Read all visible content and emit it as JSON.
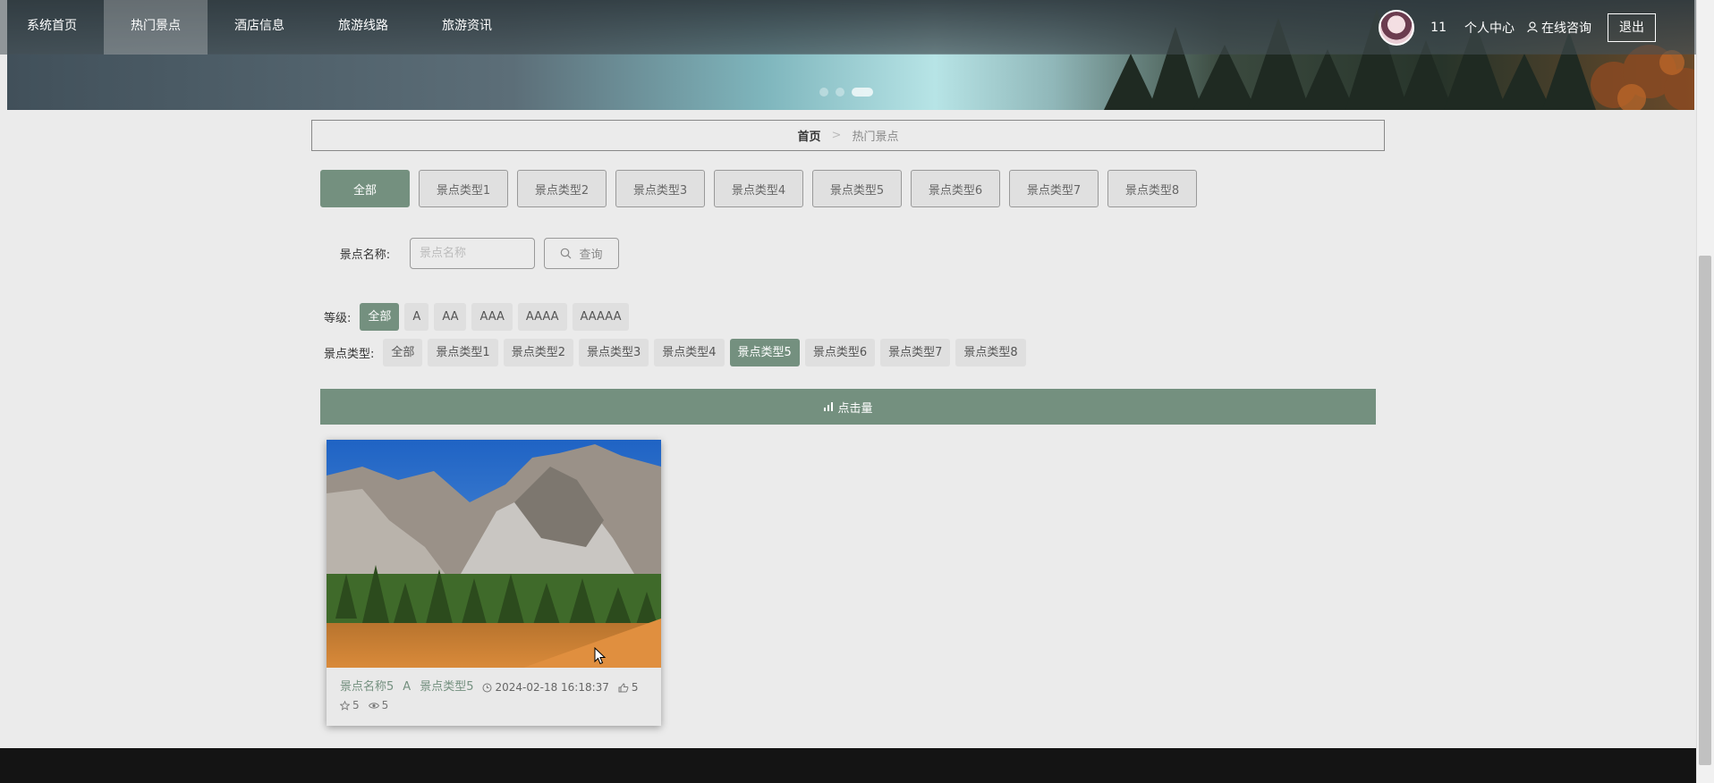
{
  "nav": {
    "items": [
      "系统首页",
      "热门景点",
      "酒店信息",
      "旅游线路",
      "旅游资讯"
    ],
    "active_index": 1,
    "user_name": "11",
    "user_center": "个人中心",
    "consult": "在线咨询",
    "logout": "退出"
  },
  "banner": {
    "dots": 3,
    "active_dot": 2
  },
  "breadcrumb": {
    "home": "首页",
    "separator": ">",
    "current": "热门景点"
  },
  "categories": {
    "items": [
      "全部",
      "景点类型1",
      "景点类型2",
      "景点类型3",
      "景点类型4",
      "景点类型5",
      "景点类型6",
      "景点类型7",
      "景点类型8"
    ],
    "active_index": 0
  },
  "search": {
    "label": "景点名称:",
    "placeholder": "景点名称",
    "value": "",
    "button": "查询"
  },
  "grade_filter": {
    "label": "等级:",
    "options": [
      "全部",
      "A",
      "AA",
      "AAA",
      "AAAA",
      "AAAAA"
    ],
    "active_index": 0
  },
  "type_filter": {
    "label": "景点类型:",
    "options": [
      "全部",
      "景点类型1",
      "景点类型2",
      "景点类型3",
      "景点类型4",
      "景点类型5",
      "景点类型6",
      "景点类型7",
      "景点类型8"
    ],
    "active_index": 5
  },
  "sort": {
    "label": "点击量",
    "icon": "bar-chart-icon"
  },
  "cards": [
    {
      "name": "景点名称5",
      "grade": "A",
      "type": "景点类型5",
      "time": "2024-02-18 16:18:37",
      "likes": "5",
      "favorites": "5",
      "views": "5"
    }
  ],
  "colors": {
    "accent": "#74907f",
    "background": "#ebebeb",
    "footer": "#141414"
  }
}
